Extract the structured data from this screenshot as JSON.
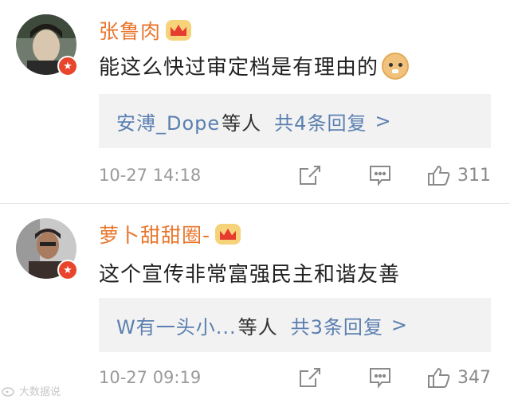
{
  "comments": [
    {
      "username": "张鲁肉",
      "text": "能这么快过审定档是有理由的",
      "reply_people": "安溥_Dope",
      "reply_suffix": "等人",
      "reply_count": "共4条回复",
      "reply_chevron": ">",
      "time": "10-27 14:18",
      "likes": "311"
    },
    {
      "username": "萝卜甜甜圈-",
      "text": "这个宣传非常富强民主和谐友善",
      "reply_people": "W有一头小...",
      "reply_suffix": "等人",
      "reply_count": "共3条回复",
      "reply_chevron": ">",
      "time": "10-27 09:19",
      "likes": "347"
    }
  ],
  "watermark": "大数据说",
  "colors": {
    "username": "#e8762c",
    "link": "#5a7fb0",
    "reply_bg": "#f2f2f2",
    "meta": "#9a9a9a",
    "badge": "#e8452c"
  }
}
